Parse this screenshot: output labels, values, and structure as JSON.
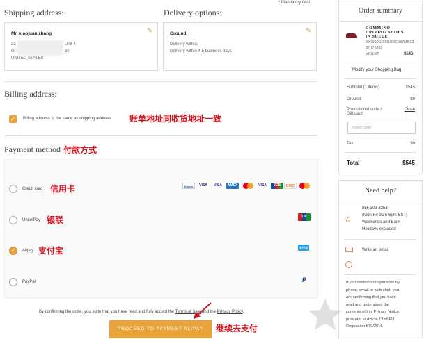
{
  "mandatory_note": "* Mandatory field",
  "shipping": {
    "heading": "Shipping address:",
    "name": "Mr. xiaojuan zhang",
    "line1_prefix": "23",
    "line1_suffix": "Unit 4",
    "line2_prefix": "Gr",
    "line2_suffix": "30",
    "country": "UNITED STATES"
  },
  "delivery": {
    "heading": "Delivery options:",
    "method": "Ground",
    "line1": "Delivery within:",
    "line2": "Delivery within 4-5 business days"
  },
  "billing": {
    "heading": "Billing address:",
    "same_label": "Billing address is the same as shipping address",
    "annotation": "账单地址同收货地址一致"
  },
  "payment": {
    "heading": "Payment method",
    "annotation": "付款方式",
    "options": [
      {
        "label": "Credit card",
        "annotation": "信用卡",
        "selected": false
      },
      {
        "label": "UnionPay",
        "annotation": "银联",
        "selected": false
      },
      {
        "label": "Alipay",
        "annotation": "支付宝",
        "selected": true
      },
      {
        "label": "PayPal",
        "annotation": "",
        "selected": false
      }
    ],
    "card_logos": [
      "Diners",
      "VISA",
      "VISA",
      "AMEX",
      "MC",
      "VISA",
      "JCB",
      "DISC",
      "MC"
    ],
    "unionpay_logo": "UP",
    "alipay_logo": "支付宝",
    "paypal_logo": "P"
  },
  "terms": {
    "prefix": "By confirming the order, you state that you have read and fully accept the ",
    "link1": "Terms of Sale",
    "middle": " and the ",
    "link2": "Privacy Policy",
    "suffix": "."
  },
  "proceed_button": "PROCEED TO PAYMENT ALIPAY",
  "proceed_annotation": "继续去支付",
  "summary": {
    "title": "Order summary",
    "product_name_1": "GOMMINO",
    "product_name_2": "DRIVING SHOES",
    "product_name_3": "IN SUEDE",
    "sku": "XXW00G00010RE037MB13",
    "size": "37 (7 US)",
    "color": "VIOLET",
    "price": "$545",
    "modify_link": "Modify your Shopping Bag",
    "subtotal_label": "Subtotal (1 items)",
    "subtotal_value": "$545",
    "ground_label": "Ground",
    "ground_value": "$0",
    "promo_label_1": "Promotional code /",
    "promo_label_2": "Gift card",
    "promo_close": "Close",
    "promo_placeholder": "Insert code",
    "tax_label": "Tax",
    "tax_value": "$0",
    "total_label": "Total",
    "total_value": "$545"
  },
  "help": {
    "title": "Need help?",
    "phone": "855 303 3253",
    "hours_1": "(Mon-Fri 9am-6pm EST)",
    "hours_2": "Weekends and Bank",
    "hours_3": "Holidays excluded",
    "email": "Write an email",
    "notice_1": "If you contact our operators by",
    "notice_2": "phone, email or web chat, you",
    "notice_3": "are confirming that you have",
    "notice_4": "read and understood the",
    "notice_5": "contents of this Privacy Notice,",
    "notice_6": "pursuant to Article 13 of EU",
    "notice_7": "Regulation 679/2016."
  },
  "colors": {
    "accent": "#e8a33a",
    "button": "#e8a33a",
    "annotation": "#d2141e",
    "link": "#333333"
  }
}
